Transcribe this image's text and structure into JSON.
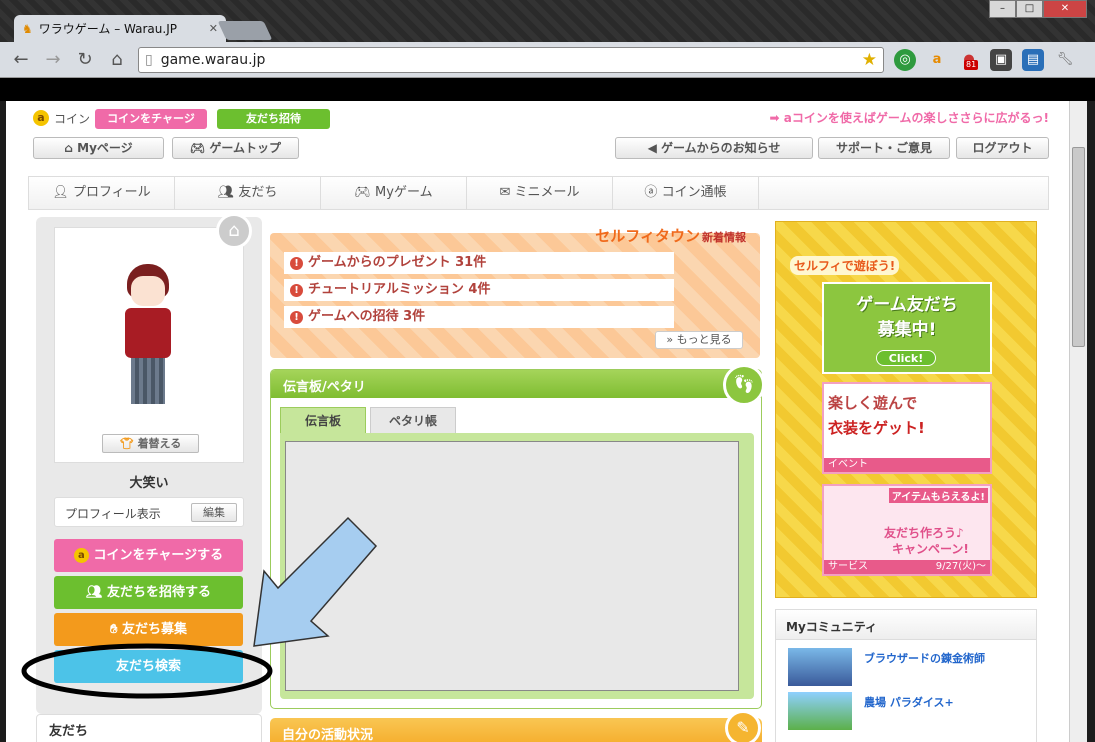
{
  "browser": {
    "tab_title": "ワラウゲーム – Warau.JP",
    "url": "game.warau.jp",
    "ext_badge": "81",
    "window_controls": [
      "–",
      "□",
      "✕"
    ]
  },
  "header": {
    "coin_label": "コイン",
    "charge_button": "コインをチャージ",
    "invite_button": "友だち招待",
    "promo_text": "➡ aコインを使えばゲームの楽しささらに広がるっ!",
    "my_page": "Myページ",
    "game_top": "ゲームトップ",
    "notices": "ゲームからのお知らせ",
    "support": "サポート・ご意見",
    "logout": "ログアウト"
  },
  "menu": [
    "プロフィール",
    "友だち",
    "Myゲーム",
    "ミニメール",
    "コイン通帳"
  ],
  "profile": {
    "dress_button": "着替える",
    "name": "大笑い",
    "profile_display": "プロフィール表示",
    "edit": "編集",
    "charge_coin": "コインをチャージする",
    "invite_friends": "友だちを招待する",
    "recruit_friends": "友だち募集",
    "search_friends": "友だち検索",
    "friends_heading": "友だち"
  },
  "news": {
    "logo": "セルフィタウン",
    "logo_sub": "新着情報",
    "items": [
      "ゲームからのプレゼント 31件",
      "チュートリアルミッション 4件",
      "ゲームへの招待 3件"
    ],
    "more": "» もっと見る"
  },
  "board": {
    "title": "伝言板/ペタリ",
    "tabs": [
      "伝言板",
      "ペタリ帳"
    ]
  },
  "activity": {
    "title": "自分の活動状況"
  },
  "ads": {
    "selfy_play": "セルフィで遊ぼう!",
    "game_friends": "ゲーム友だち",
    "recruiting": "募集中!",
    "click": "Click!",
    "fun_play": "楽しく遊んで",
    "get_clothes": "衣装をゲット!",
    "event": "イベント",
    "items_get": "アイテムもらえるよ!",
    "make_friends": "友だち作ろう♪",
    "campaign": "キャンペーン!",
    "service": "サービス",
    "date": "9/27(火)〜"
  },
  "community": {
    "title": "Myコミュニティ",
    "items": [
      "ブラウザードの錬金術師",
      "農場 パラダイス+"
    ]
  },
  "colors": {
    "pink": "#f06aa8",
    "green": "#7dc13b",
    "orange": "#f39a1c",
    "cyan": "#4cc3e8",
    "panel_green": "#8cc63f"
  }
}
